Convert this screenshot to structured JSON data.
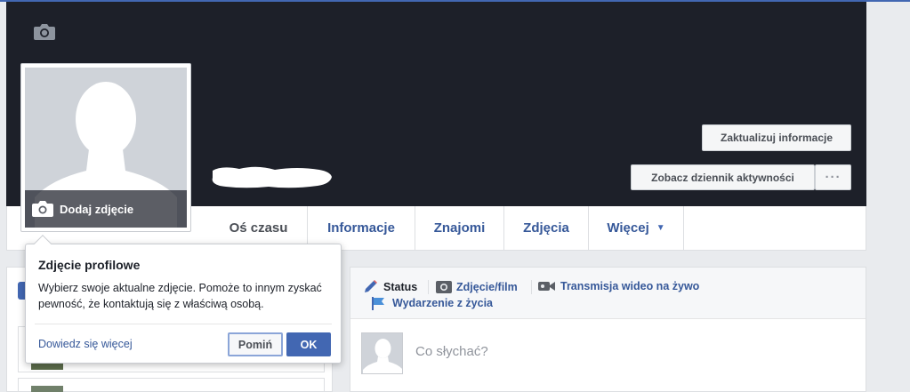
{
  "profile_header": {
    "add_photo_label": "Dodaj zdjęcie",
    "update_info_button": "Zaktualizuj informacje",
    "activity_log_button": "Zobacz dziennik aktywności",
    "more_button": "···"
  },
  "tabs": [
    {
      "label": "Oś czasu",
      "active": true
    },
    {
      "label": "Informacje",
      "active": false
    },
    {
      "label": "Znajomi",
      "active": false
    },
    {
      "label": "Zdjęcia",
      "active": false
    },
    {
      "label": "Więcej",
      "active": false
    }
  ],
  "popover": {
    "title": "Zdjęcie profilowe",
    "body": "Wybierz swoje aktualne zdjęcie. Pomoże to innym zyskać pewność, że kontaktują się z właściwą osobą.",
    "learn_more": "Dowiedz się więcej",
    "skip_button": "Pomiń",
    "ok_button": "OK"
  },
  "composer": {
    "options": [
      {
        "label": "Status",
        "icon": "pencil-icon"
      },
      {
        "label": "Zdjęcie/film",
        "icon": "camera-icon"
      },
      {
        "label": "Transmisja wideo na żywo",
        "icon": "video-camera-icon"
      },
      {
        "label": "Wydarzenie z życia",
        "icon": "flag-icon"
      }
    ],
    "placeholder": "Co słychać?"
  },
  "colors": {
    "cover": "#1d2029",
    "accent": "#4267b2",
    "link": "#365899",
    "background": "#e9ebee"
  }
}
